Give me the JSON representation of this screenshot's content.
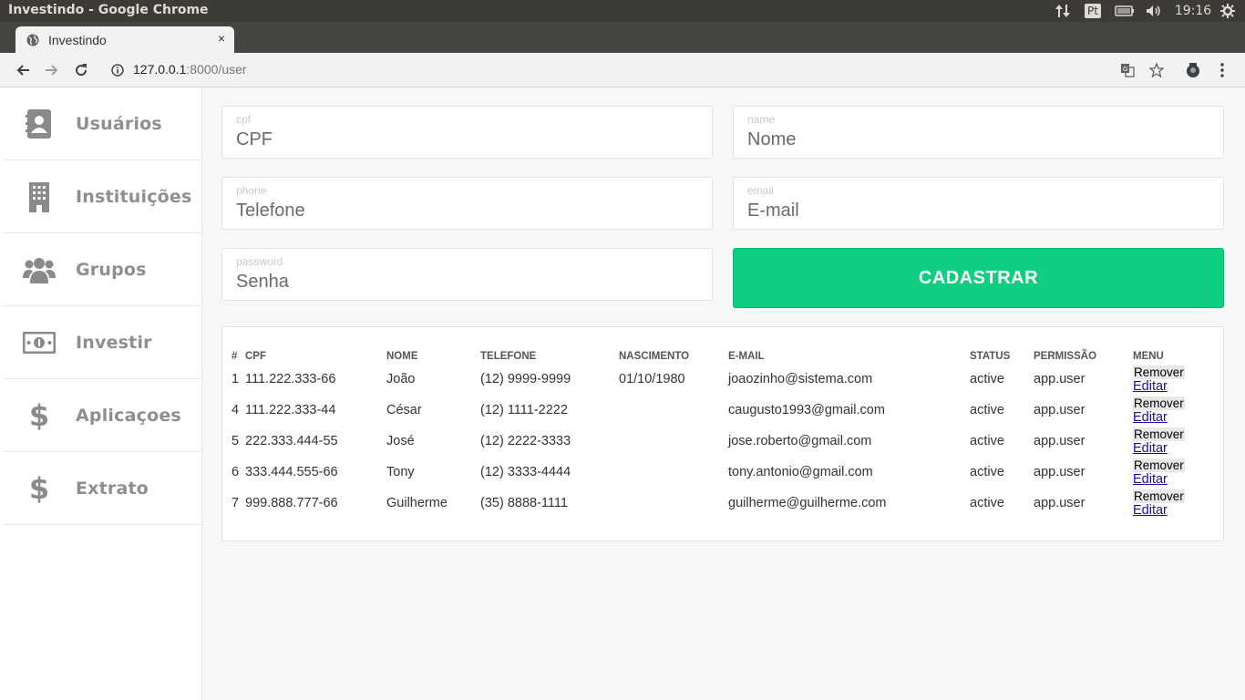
{
  "os": {
    "window_title": "Investindo - Google Chrome",
    "language_indicator": "Pt",
    "clock": "19:16",
    "icons": [
      "network-arrows-icon",
      "keyboard-layout-icon",
      "battery-icon",
      "volume-icon",
      "settings-gear-icon"
    ]
  },
  "browser": {
    "tab_title": "Investindo",
    "tab_close": "×",
    "new_tab": "+",
    "url_host": "127.0.0.1",
    "url_path": ":8000/user",
    "icons": [
      "back-arrow-icon",
      "forward-arrow-icon",
      "reload-icon",
      "info-icon",
      "translate-icon",
      "bookmark-star-icon",
      "extension-icon",
      "more-menu-icon"
    ]
  },
  "sidebar": {
    "items": [
      {
        "label": "Usuários",
        "icon": "contacts-book-icon"
      },
      {
        "label": "Instituições",
        "icon": "building-icon"
      },
      {
        "label": "Grupos",
        "icon": "group-users-icon"
      },
      {
        "label": "Investir",
        "icon": "money-bill-icon"
      },
      {
        "label": "Aplicaçoes",
        "icon": "dollar-icon"
      },
      {
        "label": "Extrato",
        "icon": "dollar-icon"
      }
    ]
  },
  "form": {
    "cpf": {
      "label": "cpf",
      "placeholder": "CPF",
      "value": ""
    },
    "name": {
      "label": "name",
      "placeholder": "Nome",
      "value": ""
    },
    "phone": {
      "label": "phone",
      "placeholder": "Telefone",
      "value": ""
    },
    "email": {
      "label": "email",
      "placeholder": "E-mail",
      "value": ""
    },
    "password": {
      "label": "password",
      "placeholder": "Senha",
      "value": ""
    },
    "submit_label": "CADASTRAR"
  },
  "table": {
    "headers": [
      "#",
      "CPF",
      "NOME",
      "TELEFONE",
      "NASCIMENTO",
      "E-MAIL",
      "STATUS",
      "PERMISSÃO",
      "MENU"
    ],
    "remove_label": "Remover",
    "edit_label": "Editar",
    "rows": [
      {
        "id": "1",
        "cpf": "111.222.333-66",
        "nome": "João",
        "telefone": "(12) 9999-9999",
        "nascimento": "01/10/1980",
        "email": "joaozinho@sistema.com",
        "status": "active",
        "permissao": "app.user"
      },
      {
        "id": "4",
        "cpf": "111.222.333-44",
        "nome": "César",
        "telefone": "(12) 1111-2222",
        "nascimento": "",
        "email": "caugusto1993@gmail.com",
        "status": "active",
        "permissao": "app.user"
      },
      {
        "id": "5",
        "cpf": "222.333.444-55",
        "nome": "José",
        "telefone": "(12) 2222-3333",
        "nascimento": "",
        "email": "jose.roberto@gmail.com",
        "status": "active",
        "permissao": "app.user"
      },
      {
        "id": "6",
        "cpf": "333.444.555-66",
        "nome": "Tony",
        "telefone": "(12) 3333-4444",
        "nascimento": "",
        "email": "tony.antonio@gmail.com",
        "status": "active",
        "permissao": "app.user"
      },
      {
        "id": "7",
        "cpf": "999.888.777-66",
        "nome": "Guilherme",
        "telefone": "(35) 8888-1111",
        "nascimento": "",
        "email": "guilherme@guilherme.com",
        "status": "active",
        "permissao": "app.user"
      }
    ]
  },
  "colors": {
    "primary_button": "#0ecf80",
    "os_bar": "#3c3b37",
    "sidebar_text": "#8f8f8f"
  }
}
